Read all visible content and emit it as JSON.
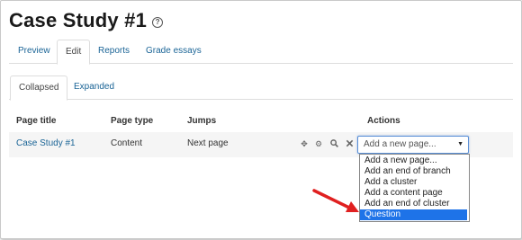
{
  "page": {
    "title": "Case Study #1",
    "help_icon": "question-circle-icon"
  },
  "tabs": [
    {
      "label": "Preview",
      "active": false
    },
    {
      "label": "Edit",
      "active": true
    },
    {
      "label": "Reports",
      "active": false
    },
    {
      "label": "Grade essays",
      "active": false
    }
  ],
  "subtabs": [
    {
      "label": "Collapsed",
      "active": true
    },
    {
      "label": "Expanded",
      "active": false
    }
  ],
  "table": {
    "headers": [
      "Page title",
      "Page type",
      "Jumps",
      "Actions"
    ],
    "rows": [
      {
        "page_title": "Case Study #1",
        "page_type": "Content",
        "jumps": "Next page",
        "action_icons": [
          "move-icon",
          "gear-icon",
          "search-icon",
          "close-icon"
        ]
      }
    ]
  },
  "add_page_select": {
    "value": "Add a new page...",
    "options": [
      "Add a new page...",
      "Add an end of branch",
      "Add a cluster",
      "Add a content page",
      "Add an end of cluster",
      "Question"
    ],
    "highlighted": "Question"
  },
  "colors": {
    "link": "#1a6496",
    "highlight": "#1e73e8",
    "arrow": "#e02020",
    "row_bg": "#f5f5f5"
  }
}
